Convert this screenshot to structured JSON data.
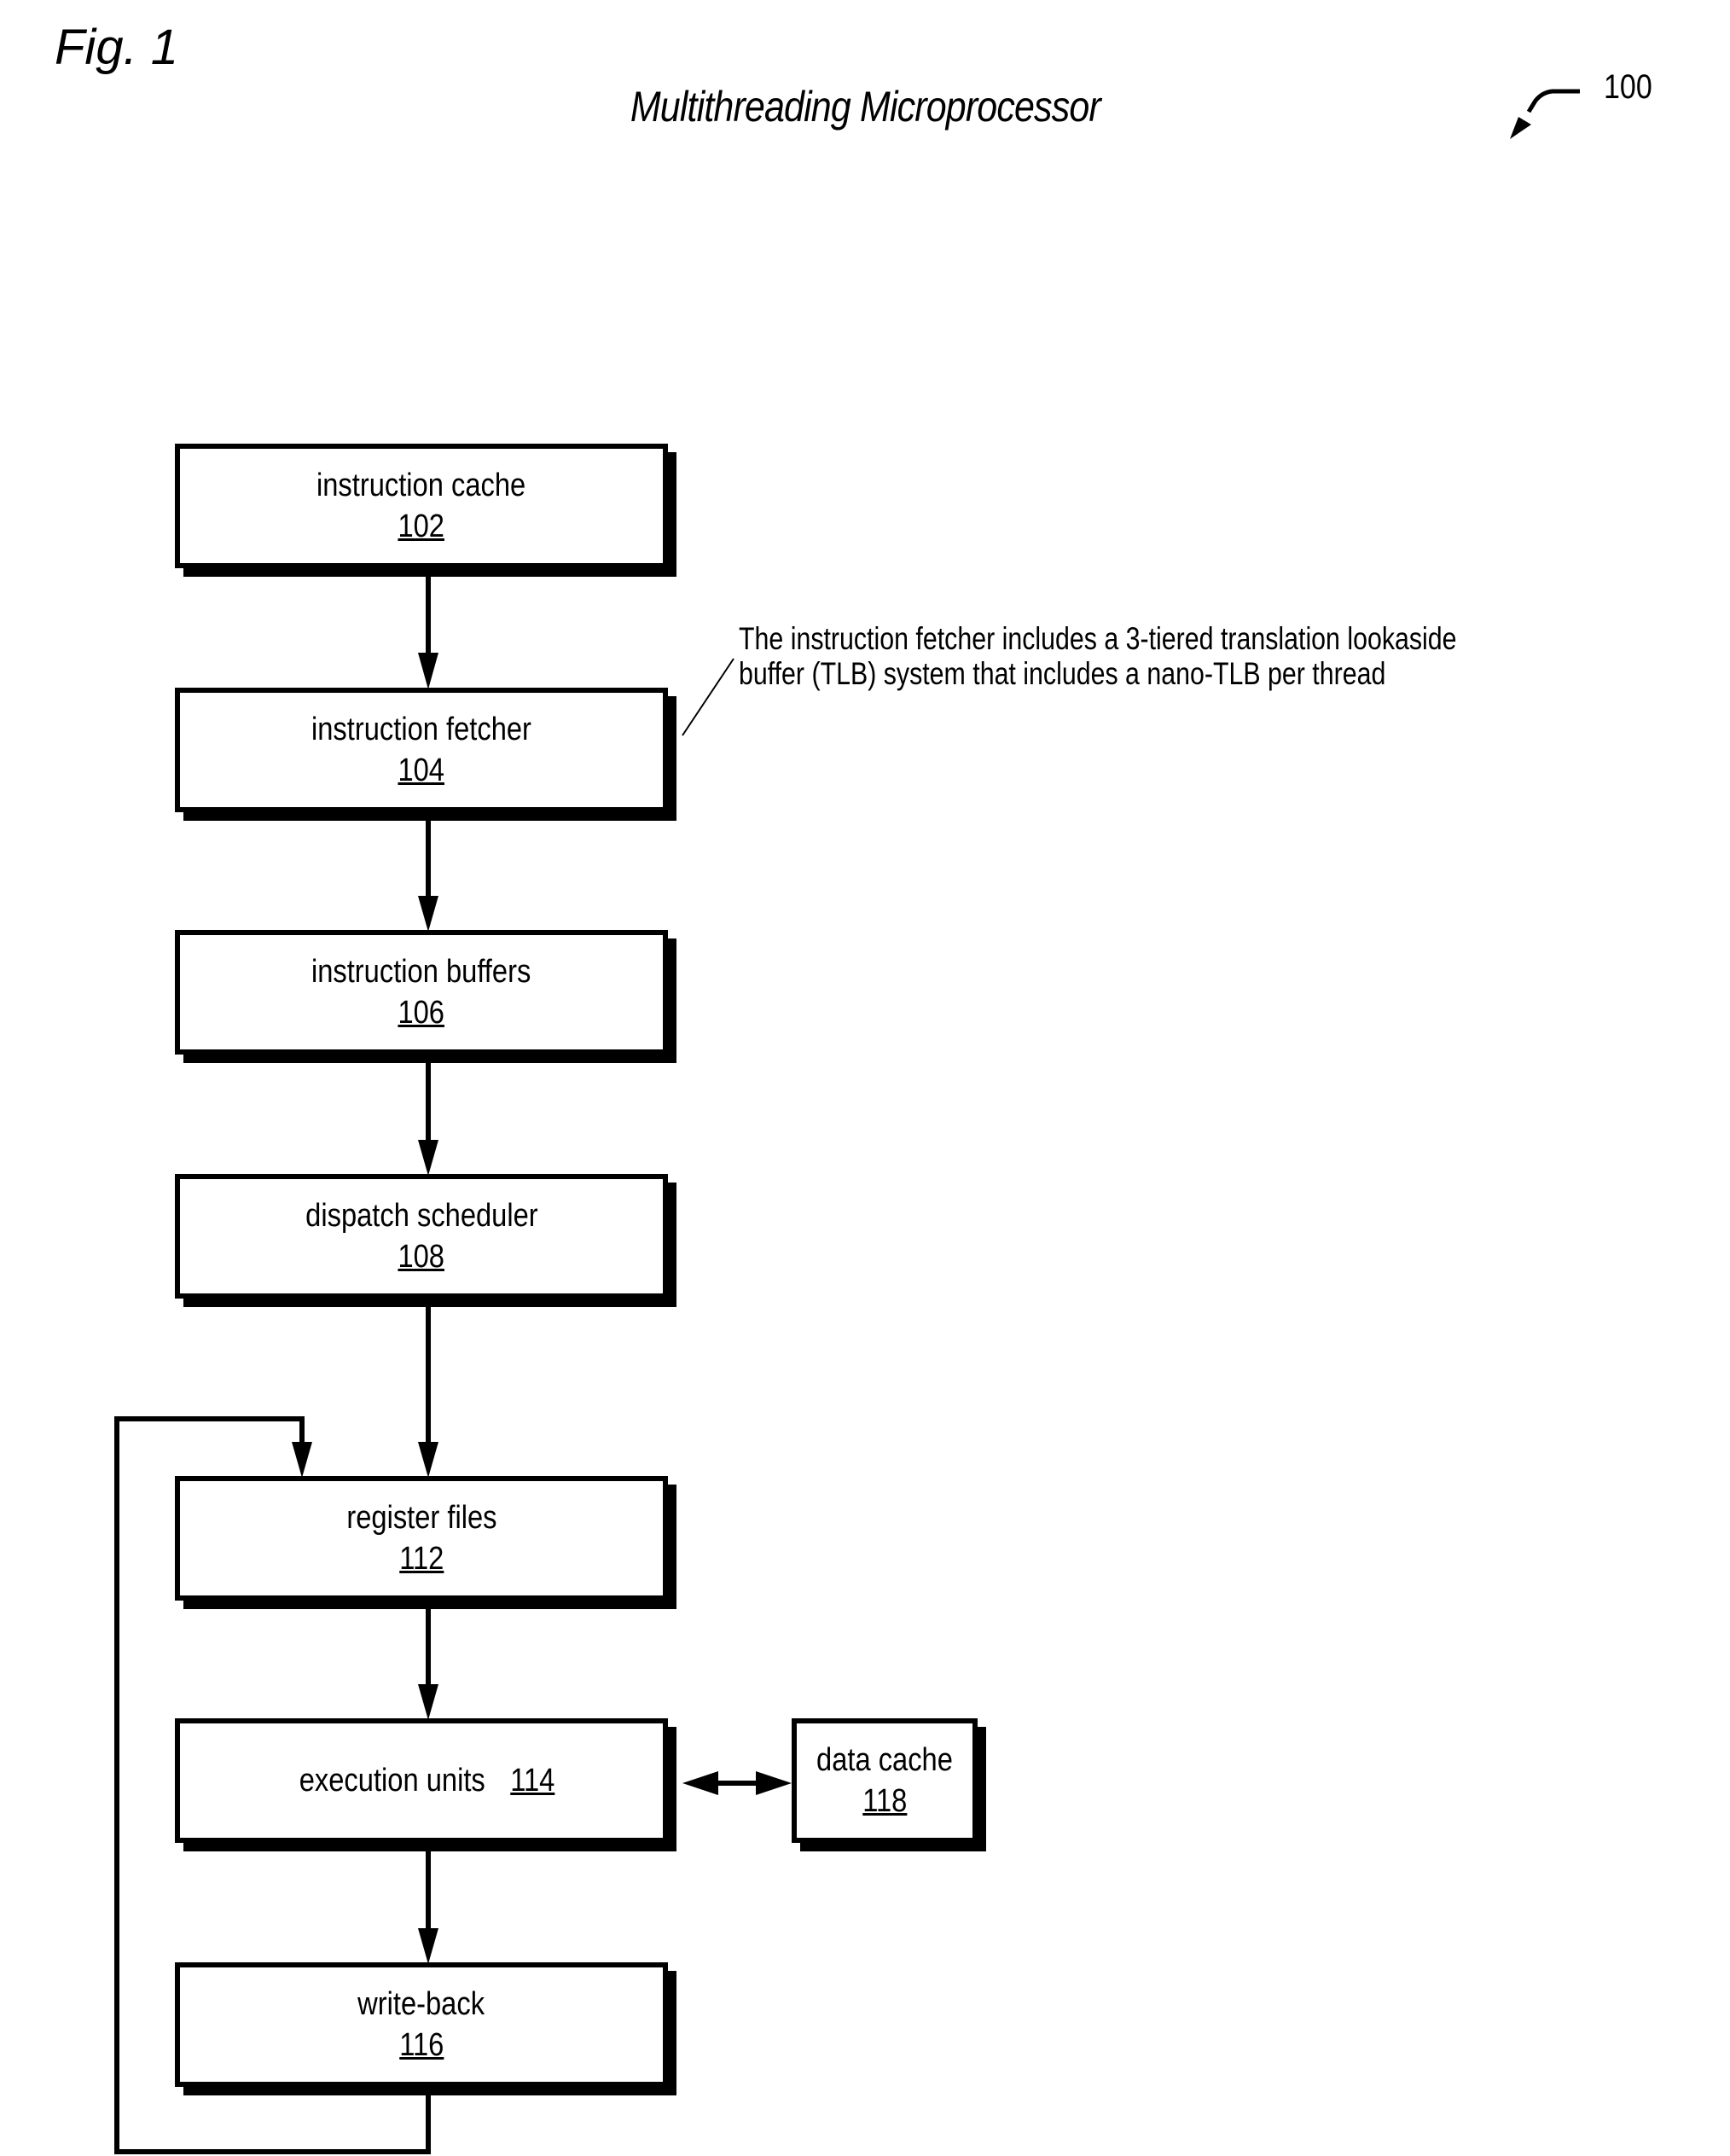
{
  "figure_label": "Fig. 1",
  "title": "Multithreading Microprocessor",
  "reference_number": "100",
  "blocks": [
    {
      "name": "instruction cache",
      "number": "102"
    },
    {
      "name": "instruction fetcher",
      "number": "104"
    },
    {
      "name": "instruction buffers",
      "number": "106"
    },
    {
      "name": "dispatch scheduler",
      "number": "108"
    },
    {
      "name": "register files",
      "number": "112"
    },
    {
      "name": "execution units",
      "number": "114"
    },
    {
      "name": "write-back",
      "number": "116"
    },
    {
      "name": "data cache",
      "number": "118"
    }
  ],
  "annotation": {
    "line1": "The instruction fetcher includes a 3-tiered translation lookaside",
    "line2": "buffer (TLB) system that includes a nano-TLB per thread"
  },
  "connections": [
    {
      "from": "102",
      "to": "104",
      "type": "arrow"
    },
    {
      "from": "104",
      "to": "106",
      "type": "arrow"
    },
    {
      "from": "106",
      "to": "108",
      "type": "arrow"
    },
    {
      "from": "108",
      "to": "112",
      "type": "arrow"
    },
    {
      "from": "112",
      "to": "114",
      "type": "arrow"
    },
    {
      "from": "114",
      "to": "118",
      "type": "bidirectional-arrow"
    },
    {
      "from": "114",
      "to": "116",
      "type": "arrow"
    },
    {
      "from": "116",
      "to": "112",
      "type": "feedback-loop-arrow"
    }
  ]
}
